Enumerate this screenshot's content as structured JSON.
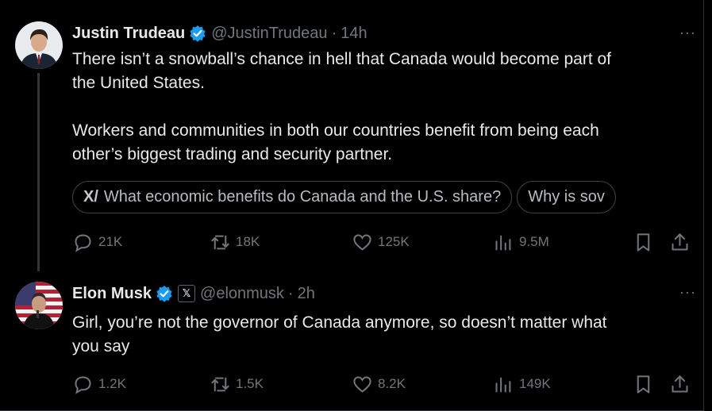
{
  "tweets": [
    {
      "name": "Justin Trudeau",
      "handle": "@JustinTrudeau",
      "time": "14h",
      "separator": "·",
      "more": "···",
      "text_line1": "There isn’t a snowball’s chance in hell that Canada would become part of",
      "text_line2": "the United States.",
      "text_line3": "Workers and communities in both our countries benefit from being each",
      "text_line4": "other’s biggest trading and security partner.",
      "grok_chips": [
        "What economic benefits do Canada and the U.S. share?",
        "Why is sov"
      ],
      "grok_icon_glyph": "X/",
      "replies": "21K",
      "reposts": "18K",
      "likes": "125K",
      "views": "9.5M",
      "verified_color": "#1d9bf0"
    },
    {
      "name": "Elon Musk",
      "handle": "@elonmusk",
      "time": "2h",
      "separator": "·",
      "more": "···",
      "badge": "𝕏",
      "text_line1": "Girl, you’re not the governor of Canada anymore, so doesn’t matter what",
      "text_line2": "you say",
      "replies": "1.2K",
      "reposts": "1.5K",
      "likes": "8.2K",
      "views": "149K",
      "verified_color": "#1d9bf0"
    }
  ]
}
